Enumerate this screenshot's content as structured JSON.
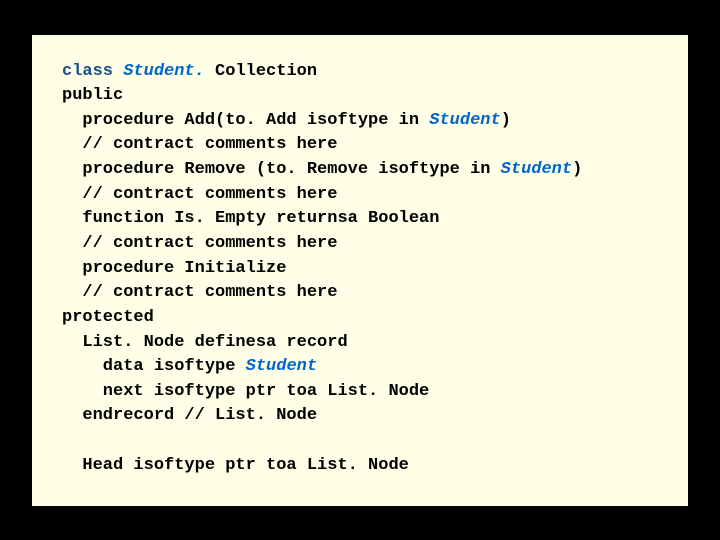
{
  "code": {
    "l1a": "class ",
    "l1b": "Student.",
    "l1c": " Collection",
    "l2": "public",
    "l3a": "  procedure Add(to. Add isoftype in ",
    "l3b": "Student",
    "l3c": ")",
    "l4": "  // contract comments here",
    "l5a": "  procedure Remove (to. Remove isoftype in ",
    "l5b": "Student",
    "l5c": ")",
    "l6": "  // contract comments here",
    "l7": "  function Is. Empty returnsa Boolean",
    "l8": "  // contract comments here",
    "l9": "  procedure Initialize",
    "l10": "  // contract comments here",
    "l11": "protected",
    "l12": "  List. Node definesa record",
    "l13a": "    data isoftype ",
    "l13b": "Student",
    "l14": "    next isoftype ptr toa List. Node",
    "l15": "  endrecord // List. Node",
    "l16": "",
    "l17": "  Head isoftype ptr toa List. Node"
  }
}
